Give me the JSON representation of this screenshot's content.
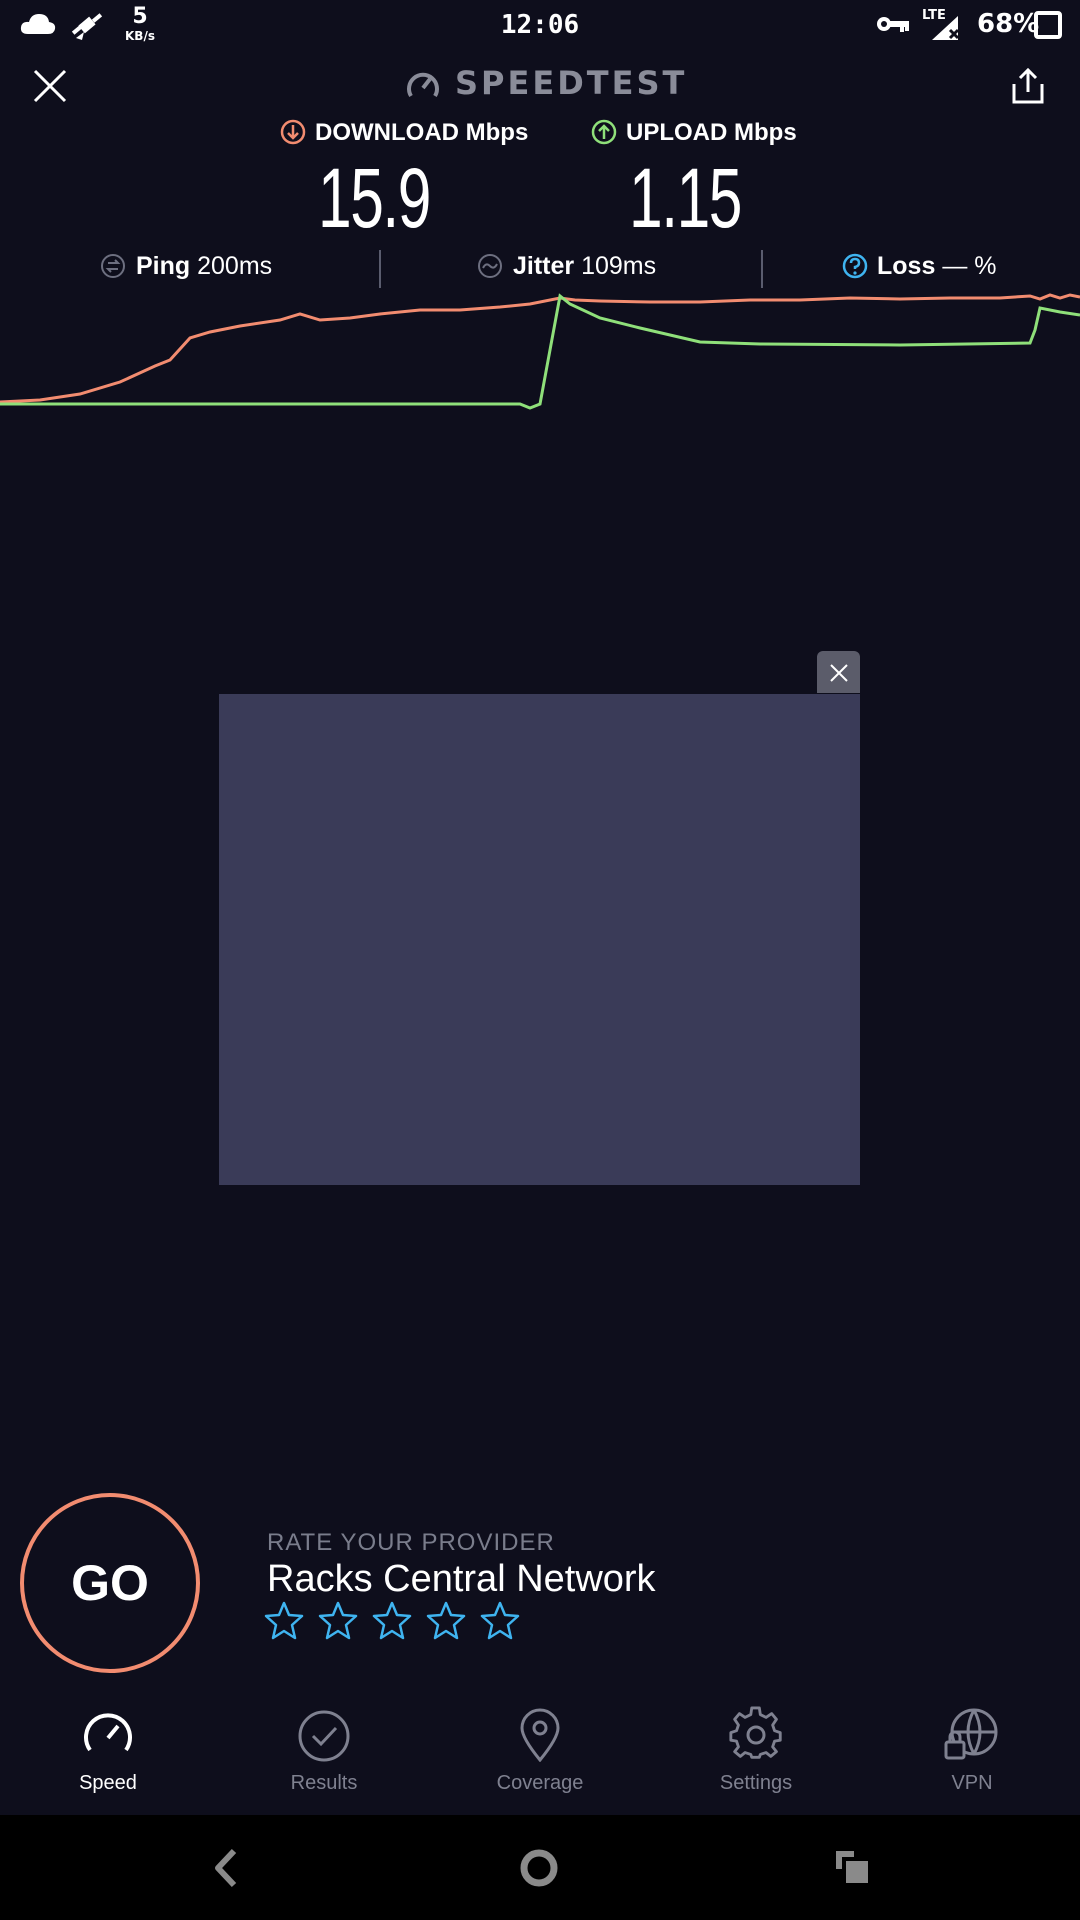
{
  "status_bar": {
    "net_speed_value": "5",
    "net_speed_unit": "KB/s",
    "time": "12:06",
    "network_type": "LTE",
    "battery": "68%"
  },
  "header": {
    "title": "SPEEDTEST"
  },
  "metrics": {
    "download_label": "DOWNLOAD Mbps",
    "download_value": "15.9",
    "upload_label": "UPLOAD Mbps",
    "upload_value": "1.15"
  },
  "stats": {
    "ping_label": "Ping",
    "ping_value": "200ms",
    "jitter_label": "Jitter",
    "jitter_value": "109ms",
    "loss_label": "Loss",
    "loss_value": "— %"
  },
  "colors": {
    "download": "#f28c70",
    "upload": "#8fe07a",
    "loss_icon": "#3fb4f0",
    "background": "#0e0e1c"
  },
  "rating": {
    "label": "RATE YOUR PROVIDER",
    "provider": "Racks Central Network",
    "stars_total": 5,
    "stars_filled": 0
  },
  "go_button": {
    "label": "GO"
  },
  "tabs": [
    {
      "label": "Speed",
      "icon": "speed-icon",
      "active": true
    },
    {
      "label": "Results",
      "icon": "results-icon",
      "active": false
    },
    {
      "label": "Coverage",
      "icon": "coverage-icon",
      "active": false
    },
    {
      "label": "Settings",
      "icon": "settings-icon",
      "active": false
    },
    {
      "label": "VPN",
      "icon": "vpn-icon",
      "active": false
    }
  ]
}
